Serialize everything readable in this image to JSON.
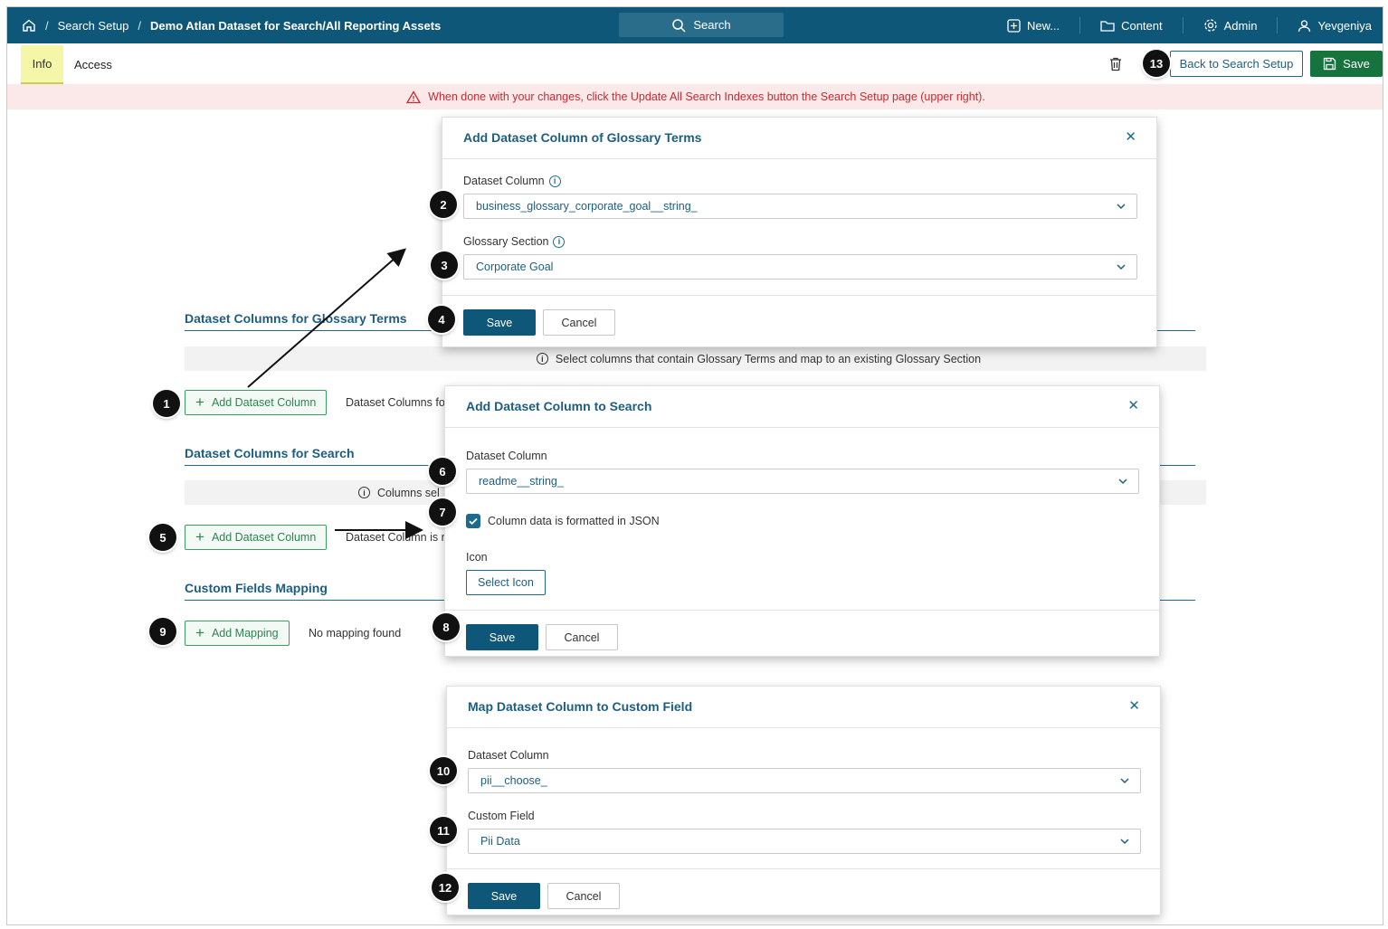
{
  "topbar": {
    "breadcrumb_1": "Search Setup",
    "breadcrumb_2": "Demo Atlan Dataset for Search/All Reporting Assets",
    "search_label": "Search",
    "new_label": "New...",
    "content_label": "Content",
    "admin_label": "Admin",
    "user_label": "Yevgeniya"
  },
  "tabs": {
    "info": "Info",
    "access": "Access"
  },
  "toolbar": {
    "back_label": "Back to Search Setup",
    "save_label": "Save"
  },
  "alert": {
    "text": "When done with your changes, click the Update All Search Indexes button the Search Setup page (upper right)."
  },
  "sections": {
    "glossary": {
      "title": "Dataset Columns for Glossary Terms",
      "info": "Select columns that contain Glossary Terms and map to an existing Glossary Section",
      "add_label": "Add Dataset Column",
      "empty_text": "Dataset Columns fo"
    },
    "search": {
      "title": "Dataset Columns for Search",
      "info": "Columns sel",
      "add_label": "Add Dataset Column",
      "empty_text": "Dataset Column is r"
    },
    "custom": {
      "title": "Custom Fields Mapping",
      "add_label": "Add Mapping",
      "empty_text": "No mapping found"
    }
  },
  "dialog_glossary": {
    "title": "Add Dataset Column of Glossary Terms",
    "column_label": "Dataset Column",
    "column_value": "business_glossary_corporate_goal__string_",
    "section_label": "Glossary Section",
    "section_value": "Corporate Goal",
    "save_label": "Save",
    "cancel_label": "Cancel"
  },
  "dialog_search": {
    "title": "Add Dataset Column to Search",
    "column_label": "Dataset Column",
    "column_value": "readme__string_",
    "json_label": "Column data is formatted in JSON",
    "json_checked": true,
    "icon_label": "Icon",
    "select_icon_label": "Select Icon",
    "save_label": "Save",
    "cancel_label": "Cancel"
  },
  "dialog_custom": {
    "title": "Map Dataset Column to Custom Field",
    "column_label": "Dataset Column",
    "column_value": "pii__choose_",
    "field_label": "Custom Field",
    "field_value": "Pii Data",
    "save_label": "Save",
    "cancel_label": "Cancel"
  },
  "steps": [
    "1",
    "2",
    "3",
    "4",
    "5",
    "6",
    "7",
    "8",
    "9",
    "10",
    "11",
    "12",
    "13"
  ],
  "colors": {
    "topbar": "#0f5778",
    "primary": "#0f5778",
    "save_green": "#17733d",
    "alert_text": "#c62a32",
    "info_tab": "#f3f7a7"
  }
}
